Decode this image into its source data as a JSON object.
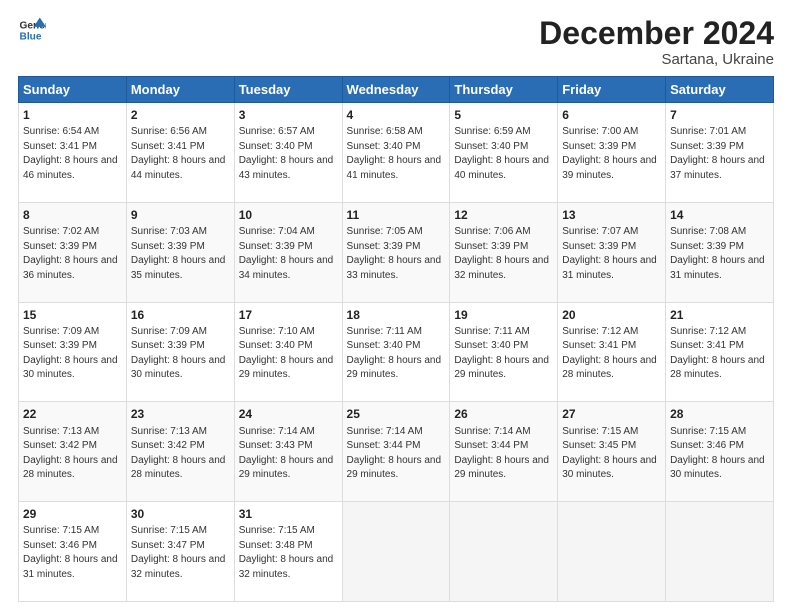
{
  "logo": {
    "line1": "General",
    "line2": "Blue"
  },
  "header": {
    "month": "December 2024",
    "location": "Sartana, Ukraine"
  },
  "weekdays": [
    "Sunday",
    "Monday",
    "Tuesday",
    "Wednesday",
    "Thursday",
    "Friday",
    "Saturday"
  ],
  "weeks": [
    [
      {
        "day": "1",
        "sunrise": "6:54 AM",
        "sunset": "3:41 PM",
        "daylight": "8 hours and 46 minutes."
      },
      {
        "day": "2",
        "sunrise": "6:56 AM",
        "sunset": "3:41 PM",
        "daylight": "8 hours and 44 minutes."
      },
      {
        "day": "3",
        "sunrise": "6:57 AM",
        "sunset": "3:40 PM",
        "daylight": "8 hours and 43 minutes."
      },
      {
        "day": "4",
        "sunrise": "6:58 AM",
        "sunset": "3:40 PM",
        "daylight": "8 hours and 41 minutes."
      },
      {
        "day": "5",
        "sunrise": "6:59 AM",
        "sunset": "3:40 PM",
        "daylight": "8 hours and 40 minutes."
      },
      {
        "day": "6",
        "sunrise": "7:00 AM",
        "sunset": "3:39 PM",
        "daylight": "8 hours and 39 minutes."
      },
      {
        "day": "7",
        "sunrise": "7:01 AM",
        "sunset": "3:39 PM",
        "daylight": "8 hours and 37 minutes."
      }
    ],
    [
      {
        "day": "8",
        "sunrise": "7:02 AM",
        "sunset": "3:39 PM",
        "daylight": "8 hours and 36 minutes."
      },
      {
        "day": "9",
        "sunrise": "7:03 AM",
        "sunset": "3:39 PM",
        "daylight": "8 hours and 35 minutes."
      },
      {
        "day": "10",
        "sunrise": "7:04 AM",
        "sunset": "3:39 PM",
        "daylight": "8 hours and 34 minutes."
      },
      {
        "day": "11",
        "sunrise": "7:05 AM",
        "sunset": "3:39 PM",
        "daylight": "8 hours and 33 minutes."
      },
      {
        "day": "12",
        "sunrise": "7:06 AM",
        "sunset": "3:39 PM",
        "daylight": "8 hours and 32 minutes."
      },
      {
        "day": "13",
        "sunrise": "7:07 AM",
        "sunset": "3:39 PM",
        "daylight": "8 hours and 31 minutes."
      },
      {
        "day": "14",
        "sunrise": "7:08 AM",
        "sunset": "3:39 PM",
        "daylight": "8 hours and 31 minutes."
      }
    ],
    [
      {
        "day": "15",
        "sunrise": "7:09 AM",
        "sunset": "3:39 PM",
        "daylight": "8 hours and 30 minutes."
      },
      {
        "day": "16",
        "sunrise": "7:09 AM",
        "sunset": "3:39 PM",
        "daylight": "8 hours and 30 minutes."
      },
      {
        "day": "17",
        "sunrise": "7:10 AM",
        "sunset": "3:40 PM",
        "daylight": "8 hours and 29 minutes."
      },
      {
        "day": "18",
        "sunrise": "7:11 AM",
        "sunset": "3:40 PM",
        "daylight": "8 hours and 29 minutes."
      },
      {
        "day": "19",
        "sunrise": "7:11 AM",
        "sunset": "3:40 PM",
        "daylight": "8 hours and 29 minutes."
      },
      {
        "day": "20",
        "sunrise": "7:12 AM",
        "sunset": "3:41 PM",
        "daylight": "8 hours and 28 minutes."
      },
      {
        "day": "21",
        "sunrise": "7:12 AM",
        "sunset": "3:41 PM",
        "daylight": "8 hours and 28 minutes."
      }
    ],
    [
      {
        "day": "22",
        "sunrise": "7:13 AM",
        "sunset": "3:42 PM",
        "daylight": "8 hours and 28 minutes."
      },
      {
        "day": "23",
        "sunrise": "7:13 AM",
        "sunset": "3:42 PM",
        "daylight": "8 hours and 28 minutes."
      },
      {
        "day": "24",
        "sunrise": "7:14 AM",
        "sunset": "3:43 PM",
        "daylight": "8 hours and 29 minutes."
      },
      {
        "day": "25",
        "sunrise": "7:14 AM",
        "sunset": "3:44 PM",
        "daylight": "8 hours and 29 minutes."
      },
      {
        "day": "26",
        "sunrise": "7:14 AM",
        "sunset": "3:44 PM",
        "daylight": "8 hours and 29 minutes."
      },
      {
        "day": "27",
        "sunrise": "7:15 AM",
        "sunset": "3:45 PM",
        "daylight": "8 hours and 30 minutes."
      },
      {
        "day": "28",
        "sunrise": "7:15 AM",
        "sunset": "3:46 PM",
        "daylight": "8 hours and 30 minutes."
      }
    ],
    [
      {
        "day": "29",
        "sunrise": "7:15 AM",
        "sunset": "3:46 PM",
        "daylight": "8 hours and 31 minutes."
      },
      {
        "day": "30",
        "sunrise": "7:15 AM",
        "sunset": "3:47 PM",
        "daylight": "8 hours and 32 minutes."
      },
      {
        "day": "31",
        "sunrise": "7:15 AM",
        "sunset": "3:48 PM",
        "daylight": "8 hours and 32 minutes."
      },
      null,
      null,
      null,
      null
    ]
  ],
  "labels": {
    "sunrise": "Sunrise:",
    "sunset": "Sunset:",
    "daylight": "Daylight:"
  }
}
